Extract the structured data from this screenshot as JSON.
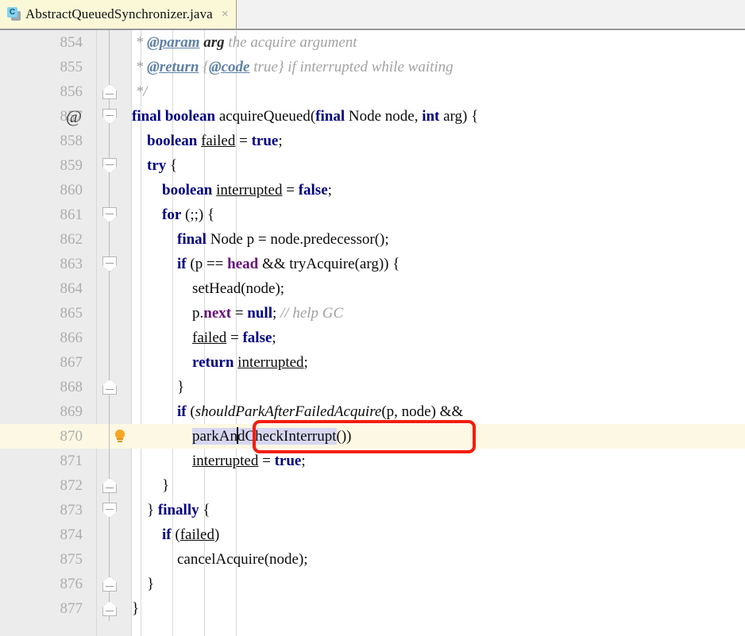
{
  "window": {
    "app": "IntelliJ IDEA Java Editor",
    "accent_red": "#f41d0e",
    "current_line_bg": "#fdf8e3",
    "selection_bg": "#d7d7f2",
    "tab_bg": "#fbf8d8",
    "gutter_bg": "#ececec"
  },
  "tab": {
    "icon": "java-class-icon",
    "icon_letter": "C",
    "label": "AbstractQueuedSynchronizer.java",
    "close": "×"
  },
  "editor": {
    "first_line": 854,
    "last_line": 877,
    "current_line": 870,
    "caret_after_text": "parkAn",
    "selected_text": "parkAndCheckInterrupt",
    "lines": [
      {
        "n": "854",
        "fold": "line",
        "icon": "",
        "indent": 0
      },
      {
        "n": "855",
        "fold": "line",
        "icon": "",
        "indent": 0
      },
      {
        "n": "856",
        "fold": "up",
        "icon": "",
        "indent": 0
      },
      {
        "n": "857",
        "fold": "down",
        "icon": "at",
        "indent": 0
      },
      {
        "n": "858",
        "fold": "line",
        "icon": "",
        "indent": 1
      },
      {
        "n": "859",
        "fold": "down",
        "icon": "",
        "indent": 1
      },
      {
        "n": "860",
        "fold": "line",
        "icon": "",
        "indent": 2
      },
      {
        "n": "861",
        "fold": "down",
        "icon": "",
        "indent": 2
      },
      {
        "n": "862",
        "fold": "line",
        "icon": "",
        "indent": 3
      },
      {
        "n": "863",
        "fold": "down",
        "icon": "",
        "indent": 3
      },
      {
        "n": "864",
        "fold": "line",
        "icon": "",
        "indent": 4
      },
      {
        "n": "865",
        "fold": "line",
        "icon": "",
        "indent": 4
      },
      {
        "n": "866",
        "fold": "line",
        "icon": "",
        "indent": 4
      },
      {
        "n": "867",
        "fold": "line",
        "icon": "",
        "indent": 4
      },
      {
        "n": "868",
        "fold": "up",
        "icon": "",
        "indent": 3
      },
      {
        "n": "869",
        "fold": "line",
        "icon": "",
        "indent": 3
      },
      {
        "n": "870",
        "fold": "line",
        "icon": "bulb",
        "indent": 4
      },
      {
        "n": "871",
        "fold": "line",
        "icon": "",
        "indent": 4
      },
      {
        "n": "872",
        "fold": "up",
        "icon": "",
        "indent": 2
      },
      {
        "n": "873",
        "fold": "down",
        "icon": "",
        "indent": 1
      },
      {
        "n": "874",
        "fold": "line",
        "icon": "",
        "indent": 2
      },
      {
        "n": "875",
        "fold": "line",
        "icon": "",
        "indent": 3
      },
      {
        "n": "876",
        "fold": "up",
        "icon": "",
        "indent": 1
      },
      {
        "n": "877",
        "fold": "up",
        "icon": "",
        "indent": 0
      }
    ],
    "code": {
      "854": " * @param arg the acquire argument",
      "855": " * @return {@code true} if interrupted while waiting",
      "856": " */",
      "857": "final boolean acquireQueued(final Node node, int arg) {",
      "858": "    boolean failed = true;",
      "859": "    try {",
      "860": "        boolean interrupted = false;",
      "861": "        for (;;) {",
      "862": "            final Node p = node.predecessor();",
      "863": "            if (p == head && tryAcquire(arg)) {",
      "864": "                setHead(node);",
      "865": "                p.next = null; // help GC",
      "866": "                failed = false;",
      "867": "                return interrupted;",
      "868": "            }",
      "869": "            if (shouldParkAfterFailedAcquire(p, node) &&",
      "870": "                parkAndCheckInterrupt())",
      "871": "                interrupted = true;",
      "872": "        }",
      "873": "    } finally {",
      "874": "        if (failed)",
      "875": "            cancelAcquire(node);",
      "876": "    }",
      "877": "}"
    }
  },
  "annotation": {
    "type": "red-rectangle-highlight",
    "target": "parkAndCheckInterrupt())",
    "color": "#f41d0e"
  }
}
